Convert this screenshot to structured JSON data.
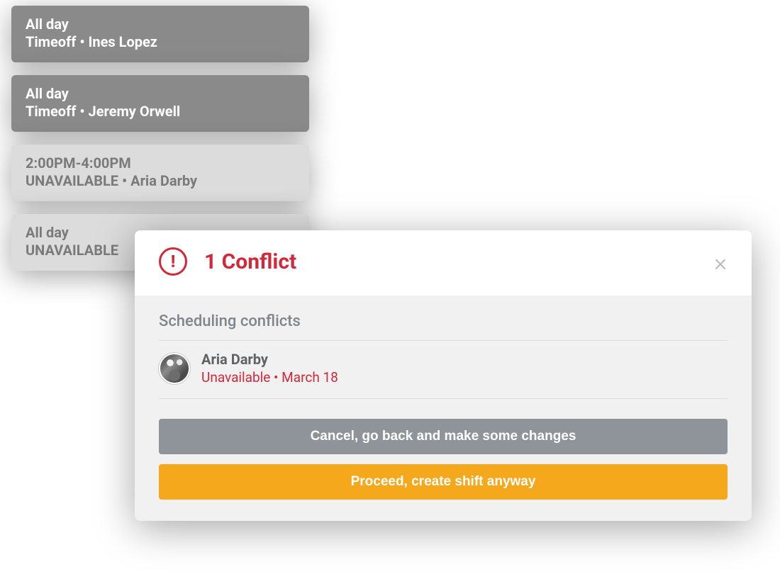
{
  "events": [
    {
      "time": "All day",
      "label": "Timeoff • Ines Lopez",
      "variant": "dark"
    },
    {
      "time": "All day",
      "label": "Timeoff • Jeremy Orwell",
      "variant": "dark"
    },
    {
      "time": "2:00PM-4:00PM",
      "label": "UNAVAILABLE • Aria Darby",
      "variant": "light"
    },
    {
      "time": "All day",
      "label": "UNAVAILABLE",
      "variant": "light"
    }
  ],
  "modal": {
    "title": "1 Conflict",
    "section_heading": "Scheduling conflicts",
    "conflict": {
      "name": "Aria Darby",
      "reason": "Unavailable • March 18"
    },
    "cancel_label": "Cancel, go back and make some changes",
    "proceed_label": "Proceed, create shift anyway"
  }
}
